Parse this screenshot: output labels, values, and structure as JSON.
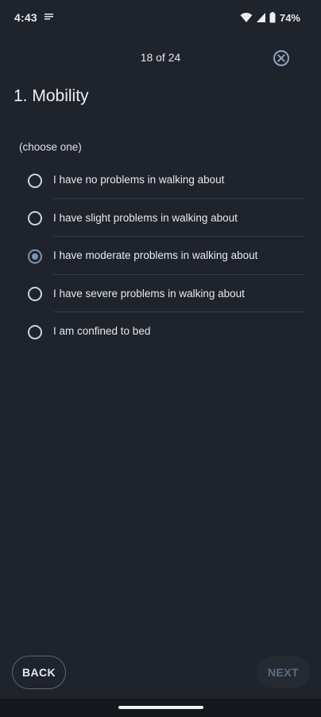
{
  "status_bar": {
    "time": "4:43",
    "battery_percent": "74%",
    "icons": [
      "notification-icon",
      "wifi-icon",
      "signal-icon",
      "battery-icon"
    ]
  },
  "header": {
    "progress": "18 of 24",
    "close_icon": "close-circle-icon"
  },
  "question": {
    "title": "1. Mobility",
    "hint": "(choose one)",
    "options": [
      {
        "label": "I have no problems in walking about",
        "selected": false
      },
      {
        "label": "I have slight problems in walking about",
        "selected": false
      },
      {
        "label": "I have moderate problems in walking about",
        "selected": true
      },
      {
        "label": "I have severe problems in walking about",
        "selected": false
      },
      {
        "label": "I am confined to bed",
        "selected": false
      }
    ]
  },
  "footer": {
    "back_label": "BACK",
    "next_label": "NEXT",
    "next_enabled": false
  },
  "colors": {
    "background": "#1f232b",
    "accent": "#7d93b5",
    "text": "#e6e8ec",
    "disabled_text": "#5e6d86"
  }
}
